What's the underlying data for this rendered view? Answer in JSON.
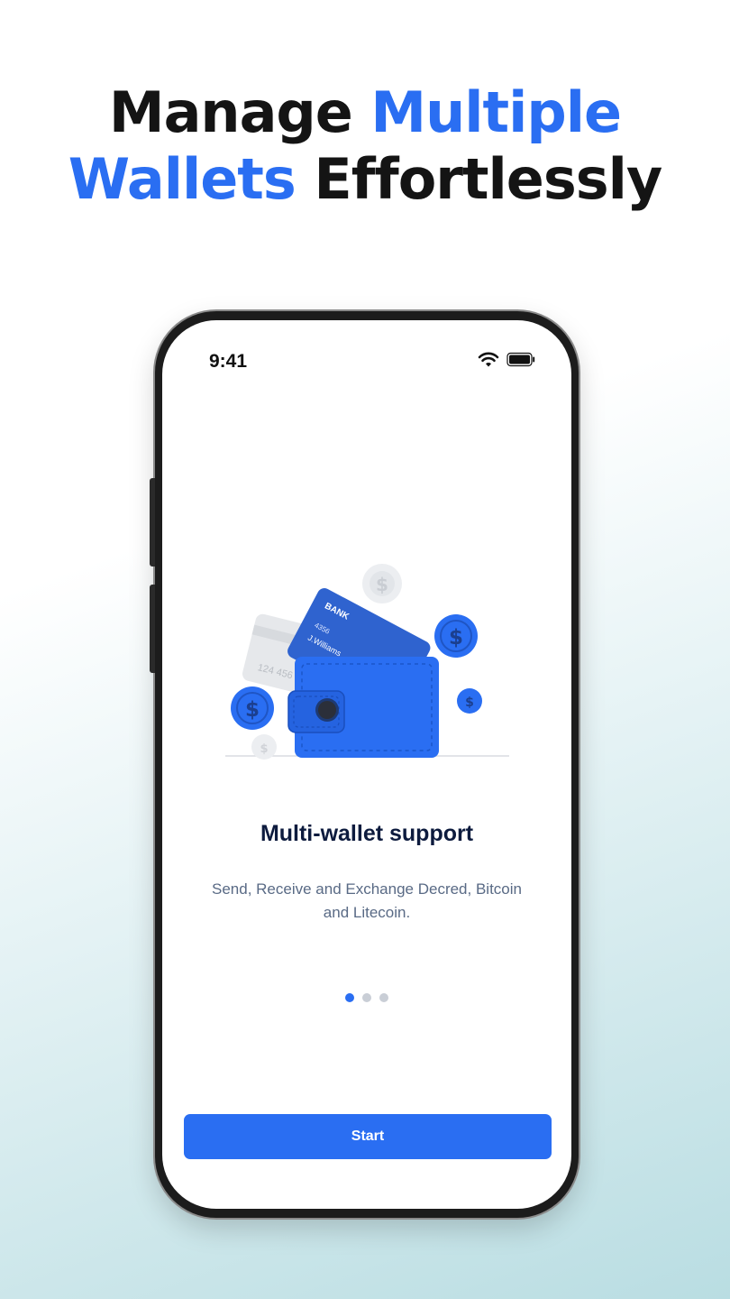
{
  "headline": {
    "line1_plain": "Manage ",
    "line1_accent": "Multiple",
    "line2_accent": "Wallets",
    "line2_plain": " Effortlessly"
  },
  "status_bar": {
    "time": "9:41",
    "icons": [
      "wifi-icon",
      "battery-icon"
    ]
  },
  "illustration": {
    "card_bank_label": "BANK",
    "card_name": "J.Williams",
    "card_number_front": "4356",
    "card_number_back": "124 456",
    "coin_symbol": "$"
  },
  "onboarding": {
    "title": "Multi-wallet support",
    "description": "Send, Receive and Exchange Decred, Bitcoin and Litecoin.",
    "page_count": 3,
    "current_page": 1
  },
  "start_button": {
    "label": "Start"
  },
  "colors": {
    "accent": "#2a6ef2",
    "title": "#0d1b3e",
    "body_text": "#596a85"
  }
}
